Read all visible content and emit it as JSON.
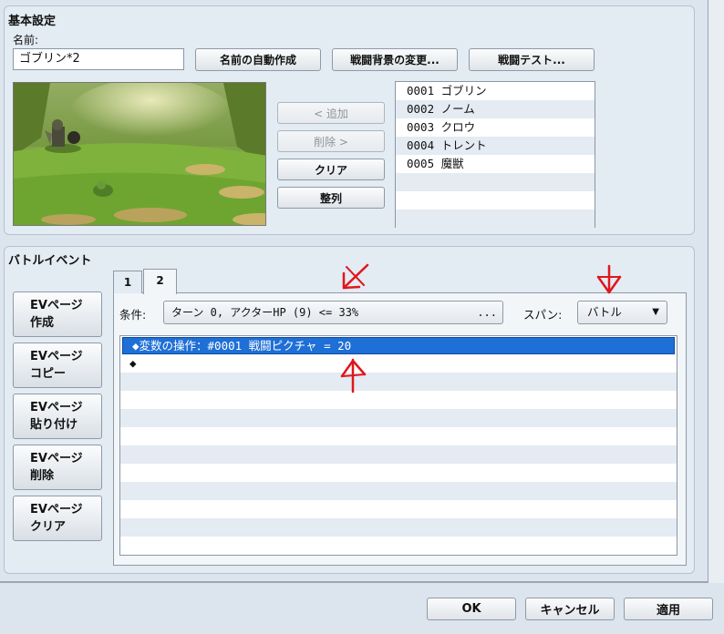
{
  "basic_settings": {
    "title": "基本設定",
    "name_label": "名前:",
    "name_value": "ゴブリン*2",
    "auto_name_button": "名前の自動作成",
    "change_bg_button": "戦闘背景の変更...",
    "battle_test_button": "戦闘テスト...",
    "add_button": "< 追加",
    "remove_button": "削除 >",
    "clear_button": "クリア",
    "arrange_button": "整列",
    "enemies": [
      {
        "id": "0001",
        "name": "ゴブリン"
      },
      {
        "id": "0002",
        "name": "ノーム"
      },
      {
        "id": "0003",
        "name": "クロウ"
      },
      {
        "id": "0004",
        "name": "トレント"
      },
      {
        "id": "0005",
        "name": "魔獣"
      }
    ]
  },
  "battle_event": {
    "title": "バトルイベント",
    "side_buttons": [
      {
        "line1": "EVページ",
        "line2": "作成"
      },
      {
        "line1": "EVページ",
        "line2": "コピー"
      },
      {
        "line1": "EVページ",
        "line2": "貼り付け"
      },
      {
        "line1": "EVページ",
        "line2": "削除"
      },
      {
        "line1": "EVページ",
        "line2": "クリア"
      }
    ],
    "tabs": [
      "1",
      "2"
    ],
    "active_tab": "2",
    "condition_label": "条件:",
    "condition_value": "ターン 0, アクターHP (9) <= 33%",
    "condition_button": "...",
    "span_label": "スパン:",
    "span_value": "バトル",
    "commands": [
      "◆変数の操作：#0001 戦闘ピクチャ = 20",
      "◆"
    ]
  },
  "footer": {
    "ok": "OK",
    "cancel": "キャンセル",
    "apply": "適用"
  },
  "colors": {
    "selection": "#1e6fd6",
    "annotation": "#e0161b"
  }
}
